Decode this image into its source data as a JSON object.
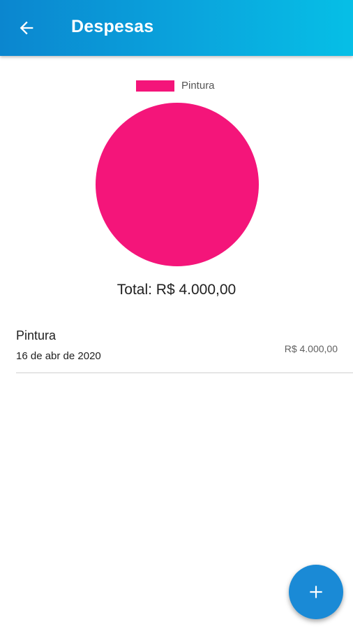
{
  "appbar": {
    "title": "Despesas",
    "back_icon": "arrow-left-icon",
    "gradient": [
      "#0b86cf",
      "#06bfe6"
    ]
  },
  "chart_data": {
    "type": "pie",
    "categories": [
      "Pintura"
    ],
    "values": [
      4000
    ],
    "colors": [
      "#f4157a"
    ],
    "legend": "top"
  },
  "total_label": "Total: R$ 4.000,00",
  "expenses": [
    {
      "name": "Pintura",
      "date": "16 de abr de 2020",
      "value": "R$ 4.000,00"
    }
  ],
  "fab": {
    "icon": "plus-icon",
    "color": "#1a8ad6"
  }
}
